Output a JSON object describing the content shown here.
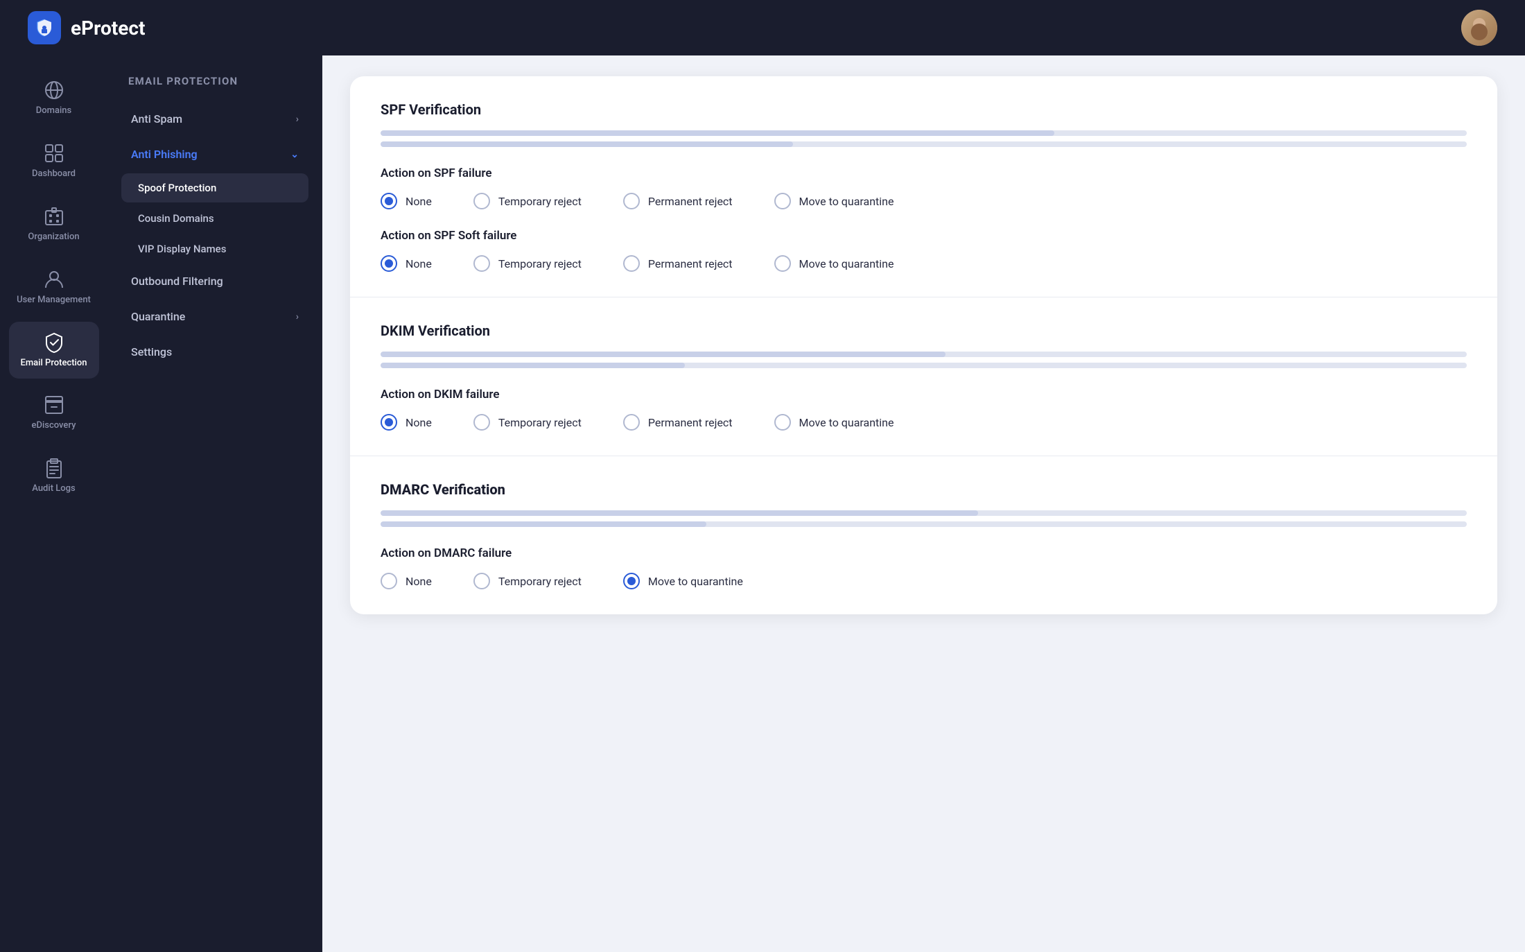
{
  "brand": {
    "name": "eProtect"
  },
  "topbar": {
    "avatar_label": "User avatar"
  },
  "sidebar": {
    "items": [
      {
        "id": "domains",
        "label": "Domains",
        "icon": "globe"
      },
      {
        "id": "dashboard",
        "label": "Dashboard",
        "icon": "grid"
      },
      {
        "id": "organization",
        "label": "Organization",
        "icon": "building"
      },
      {
        "id": "user-management",
        "label": "User Management",
        "icon": "user"
      },
      {
        "id": "email-protection",
        "label": "Email Protection",
        "icon": "shield",
        "active": true
      },
      {
        "id": "ediscovery",
        "label": "eDiscovery",
        "icon": "archive"
      },
      {
        "id": "audit-logs",
        "label": "Audit Logs",
        "icon": "clipboard"
      }
    ]
  },
  "sub_sidebar": {
    "title": "EMAIL PROTECTION",
    "items": [
      {
        "id": "anti-spam",
        "label": "Anti Spam",
        "has_arrow": true
      },
      {
        "id": "anti-phishing",
        "label": "Anti Phishing",
        "has_arrow": true,
        "active": true,
        "sub_items": [
          {
            "id": "spoof-protection",
            "label": "Spoof Protection",
            "selected": true
          },
          {
            "id": "cousin-domains",
            "label": "Cousin Domains"
          },
          {
            "id": "vip-display-names",
            "label": "VIP Display Names"
          }
        ]
      },
      {
        "id": "outbound-filtering",
        "label": "Outbound Filtering",
        "has_arrow": false
      },
      {
        "id": "quarantine",
        "label": "Quarantine",
        "has_arrow": true
      },
      {
        "id": "settings",
        "label": "Settings",
        "has_arrow": false
      }
    ]
  },
  "main": {
    "sections": [
      {
        "id": "spf",
        "title": "SPF Verification",
        "bold": false,
        "progress_bars": [
          {
            "width": "62%"
          },
          {
            "width": "38%"
          }
        ],
        "action_groups": [
          {
            "label": "Action on SPF failure",
            "options": [
              {
                "id": "spf-fail-none",
                "label": "None",
                "checked": true
              },
              {
                "id": "spf-fail-temp",
                "label": "Temporary reject",
                "checked": false
              },
              {
                "id": "spf-fail-perm",
                "label": "Permanent reject",
                "checked": false
              },
              {
                "id": "spf-fail-quarantine",
                "label": "Move to quarantine",
                "checked": false
              }
            ]
          },
          {
            "label": "Action on SPF Soft failure",
            "options": [
              {
                "id": "spf-soft-none",
                "label": "None",
                "checked": true
              },
              {
                "id": "spf-soft-temp",
                "label": "Temporary reject",
                "checked": false
              },
              {
                "id": "spf-soft-perm",
                "label": "Permanent reject",
                "checked": false
              },
              {
                "id": "spf-soft-quarantine",
                "label": "Move to quarantine",
                "checked": false
              }
            ]
          }
        ]
      },
      {
        "id": "dkim",
        "title": "DKIM Verification",
        "bold": false,
        "progress_bars": [
          {
            "width": "52%"
          },
          {
            "width": "28%"
          }
        ],
        "action_groups": [
          {
            "label": "Action on DKIM failure",
            "options": [
              {
                "id": "dkim-fail-none",
                "label": "None",
                "checked": true
              },
              {
                "id": "dkim-fail-temp",
                "label": "Temporary reject",
                "checked": false
              },
              {
                "id": "dkim-fail-perm",
                "label": "Permanent reject",
                "checked": false
              },
              {
                "id": "dkim-fail-quarantine",
                "label": "Move to quarantine",
                "checked": false
              }
            ]
          }
        ]
      },
      {
        "id": "dmarc",
        "title": "DMARC Verification",
        "bold": true,
        "progress_bars": [
          {
            "width": "55%"
          },
          {
            "width": "30%"
          }
        ],
        "action_groups": [
          {
            "label": "Action on DMARC failure",
            "options": [
              {
                "id": "dmarc-fail-none",
                "label": "None",
                "checked": false
              },
              {
                "id": "dmarc-fail-temp",
                "label": "Temporary reject",
                "checked": false
              },
              {
                "id": "dmarc-fail-quarantine",
                "label": "Move to quarantine",
                "checked": true
              }
            ]
          }
        ]
      }
    ]
  }
}
